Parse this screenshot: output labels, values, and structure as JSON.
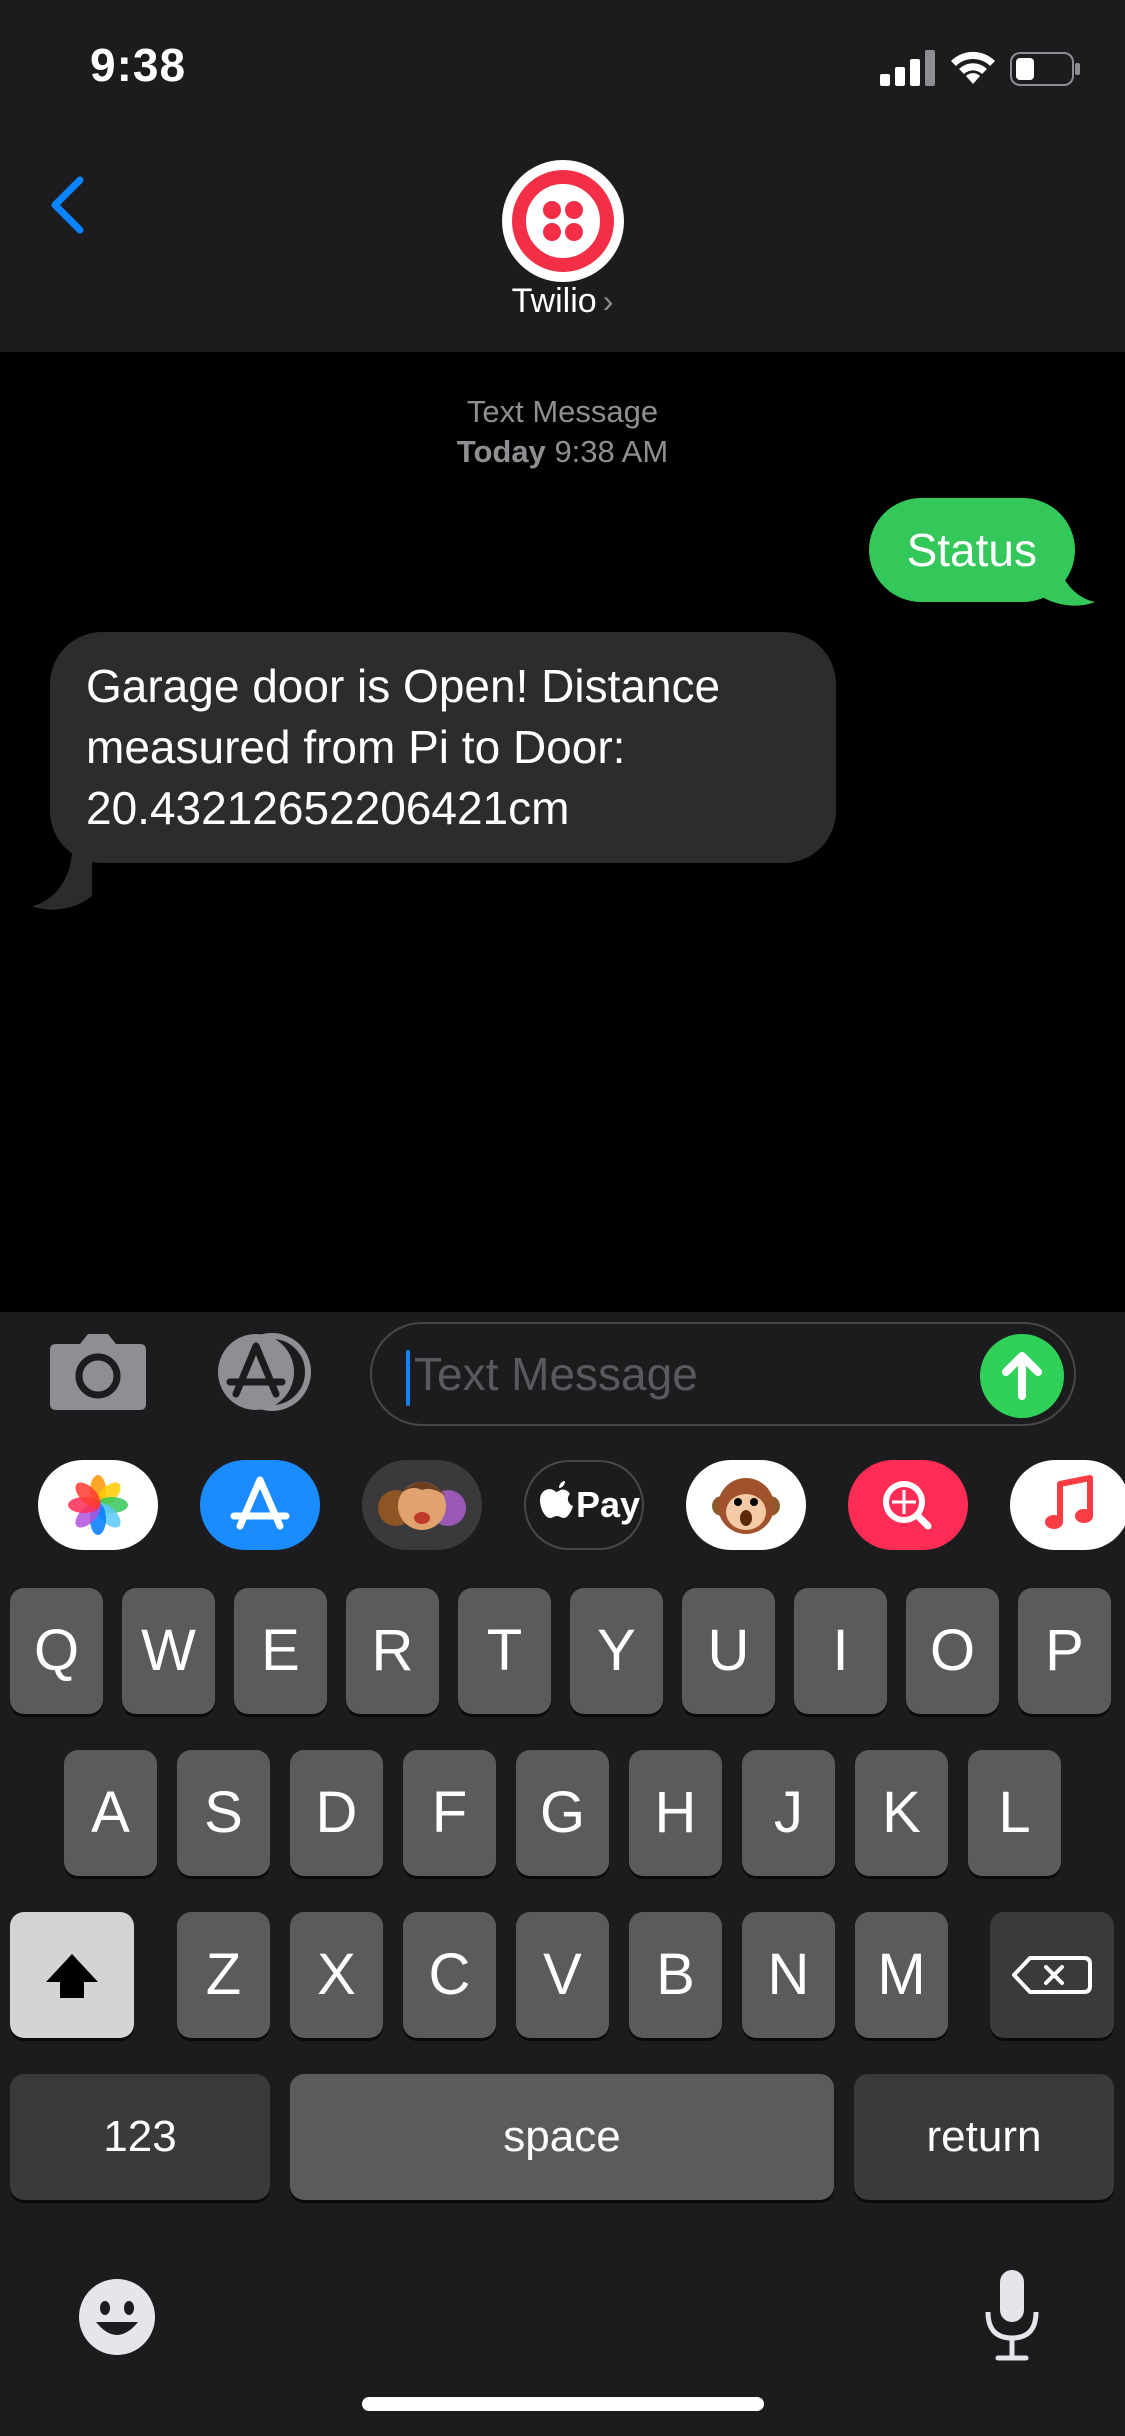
{
  "status_bar": {
    "time": "9:38"
  },
  "header": {
    "contact_name": "Twilio",
    "chevron": "›",
    "avatar_icon": "twilio-logo-icon",
    "accent": "#f22f46",
    "back_color": "#0a84ff"
  },
  "thread": {
    "meta_label": "Text Message",
    "meta_day": "Today",
    "meta_time": "9:38 AM",
    "messages": [
      {
        "direction": "outgoing",
        "text": "Status",
        "color": "#34c759"
      },
      {
        "direction": "incoming",
        "text": "Garage door is Open! Distance measured from Pi to Door: 20.43212652206421cm",
        "color": "#2c2c2e"
      }
    ]
  },
  "composer": {
    "placeholder": "Text Message",
    "send_color": "#30d158"
  },
  "app_drawer": [
    "photos-icon",
    "app-store-icon",
    "memoji-icon",
    "apple-pay-icon",
    "animoji-icon",
    "image-search-icon",
    "music-icon"
  ],
  "apple_pay_label": "Pay",
  "keyboard": {
    "row1": [
      "Q",
      "W",
      "E",
      "R",
      "T",
      "Y",
      "U",
      "I",
      "O",
      "P"
    ],
    "row2": [
      "A",
      "S",
      "D",
      "F",
      "G",
      "H",
      "J",
      "K",
      "L"
    ],
    "row3": [
      "Z",
      "X",
      "C",
      "V",
      "B",
      "N",
      "M"
    ],
    "numbers_label": "123",
    "space_label": "space",
    "return_label": "return"
  }
}
